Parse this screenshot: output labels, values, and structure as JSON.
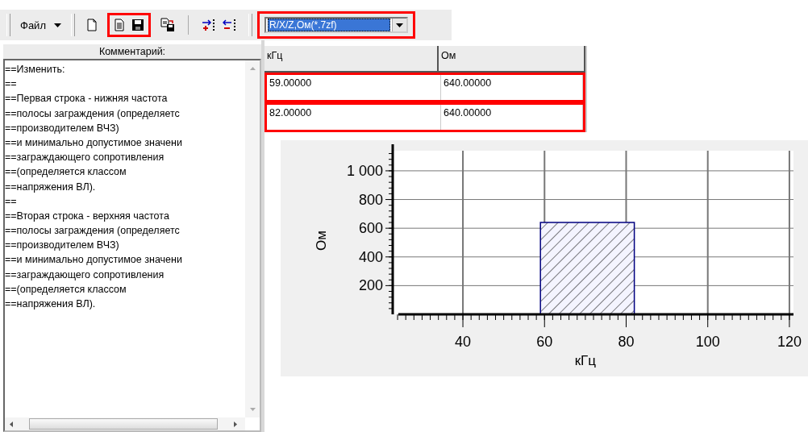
{
  "toolbar": {
    "menu_button": {
      "label": "Файл"
    },
    "groups": [
      {
        "highlighted": false,
        "buttons": [
          {
            "kind": "new"
          }
        ]
      },
      {
        "highlighted": true,
        "buttons": [
          {
            "kind": "document"
          },
          {
            "kind": "save"
          }
        ]
      },
      {
        "highlighted": false,
        "buttons": [
          {
            "kind": "save-copy"
          }
        ]
      },
      {
        "highlighted": false,
        "separator_before": true,
        "buttons": [
          {
            "kind": "add-row"
          },
          {
            "kind": "remove-row"
          }
        ]
      }
    ],
    "combo": {
      "value": "R/X/Z,Ом(*.7zf)",
      "highlighted": true
    }
  },
  "comment_panel": {
    "header": "Комментарий:",
    "lines": [
      "==Изменить:",
      "==",
      "==Первая строка - нижняя частота",
      "==полосы заграждения (определяетс",
      "==производителем ВЧЗ)",
      "==и минимально допустимое значени",
      "==заграждающего сопротивления",
      "==(определяется классом",
      "==напряжения ВЛ).",
      "==",
      "==Вторая строка - верхняя частота",
      "==полосы заграждения (определяетс",
      "==производителем ВЧЗ)",
      "==и минимально допустимое значени",
      "==заграждающего сопротивления",
      "==(определяется классом",
      "==напряжения ВЛ)."
    ]
  },
  "table": {
    "columns": [
      "кГц",
      "Ом"
    ],
    "rows": [
      {
        "cells": [
          "59.00000",
          "640.00000"
        ],
        "highlighted": true
      },
      {
        "cells": [
          "82.00000",
          "640.00000"
        ],
        "highlighted": true
      }
    ]
  },
  "chart": {
    "chart_data": {
      "type": "area",
      "xlabel": "кГц",
      "ylabel": "Ом",
      "x": [
        59,
        82
      ],
      "series": [
        {
          "color": "#000080",
          "values": [
            640,
            640
          ]
        }
      ],
      "grid": true,
      "xlim": [
        23,
        121
      ],
      "ylim": [
        0,
        1140
      ],
      "xticks": [
        40,
        60,
        80,
        100,
        120
      ],
      "yticks": [
        200,
        400,
        600,
        800,
        {
          "value": 1000,
          "label": "1 000"
        }
      ]
    }
  }
}
